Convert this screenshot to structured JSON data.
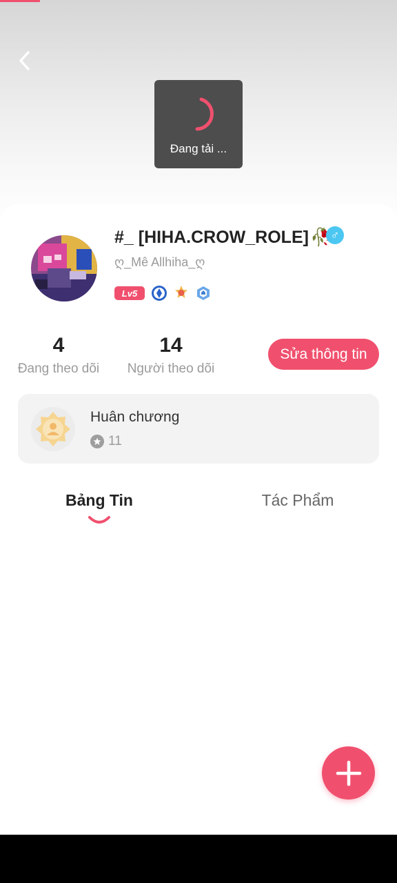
{
  "loading": {
    "text": "Đang tải ..."
  },
  "profile": {
    "username": "#_ [HIHA.CROW_ROLE]",
    "username_emoji": "🥀",
    "gender_symbol": "♂",
    "subname": "ღ_Mê Allhiha_ღ",
    "level_label": "Lv5"
  },
  "stats": {
    "following_count": "4",
    "following_label": "Đang theo dõi",
    "followers_count": "14",
    "followers_label": "Người theo dõi"
  },
  "edit_button_label": "Sửa thông tin",
  "medals": {
    "title": "Huân chương",
    "count": "11"
  },
  "tabs": [
    {
      "label": "Bảng Tin",
      "active": true
    },
    {
      "label": "Tác Phẩm",
      "active": false
    }
  ],
  "colors": {
    "accent": "#f0506e",
    "gender": "#4cc7f2",
    "toast": "#4d4d4d"
  },
  "icons": {
    "back": "chevron-left-icon",
    "spinner": "loading-spinner-icon",
    "fab": "plus-icon",
    "medal": "medal-icon"
  }
}
